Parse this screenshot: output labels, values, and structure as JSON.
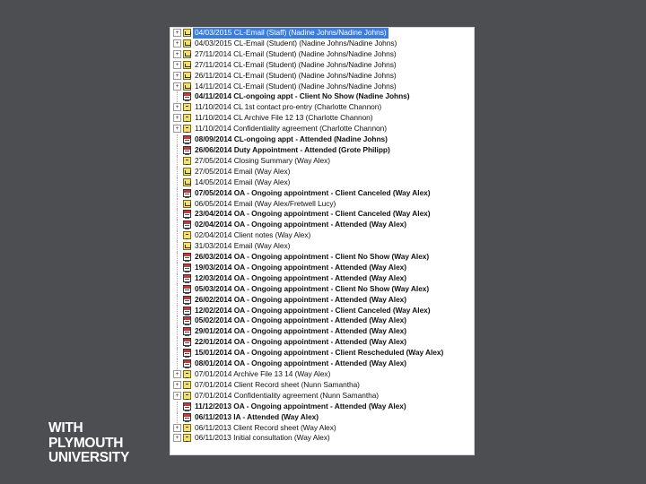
{
  "items": [
    {
      "expander": "+",
      "icon": "email-icon",
      "label": "04/03/2015 CL-Email (Staff) (Nadine Johns/Nadine Johns)",
      "bold": false,
      "selected": true
    },
    {
      "expander": "+",
      "icon": "email-icon",
      "label": "04/03/2015 CL-Email (Student) (Nadine Johns/Nadine Johns)",
      "bold": false
    },
    {
      "expander": "+",
      "icon": "email-icon",
      "label": "27/11/2014 CL-Email (Student) (Nadine Johns/Nadine Johns)",
      "bold": false
    },
    {
      "expander": "+",
      "icon": "email-icon",
      "label": "27/11/2014 CL-Email (Student) (Nadine Johns/Nadine Johns)",
      "bold": false
    },
    {
      "expander": "+",
      "icon": "email-icon",
      "label": "26/11/2014 CL-Email (Student) (Nadine Johns/Nadine Johns)",
      "bold": false
    },
    {
      "expander": "+",
      "icon": "email-icon",
      "label": "14/11/2014 CL-Email (Student) (Nadine Johns/Nadine Johns)",
      "bold": false
    },
    {
      "expander": "",
      "icon": "appointment-icon",
      "label": "04/11/2014 CL-ongoing appt - Client No Show (Nadine Johns)",
      "bold": true
    },
    {
      "expander": "+",
      "icon": "document-icon",
      "label": "11/10/2014 CL 1st contact pro-entry (Charlotte Channon)",
      "bold": false
    },
    {
      "expander": "+",
      "icon": "document-icon",
      "label": "11/10/2014 CL Archive File 12 13 (Charlotte Channon)",
      "bold": false
    },
    {
      "expander": "+",
      "icon": "document-icon",
      "label": "11/10/2014 Confidentiality agreement (Charlotte Channon)",
      "bold": false
    },
    {
      "expander": "",
      "icon": "appointment-icon",
      "label": "08/09/2014 CL-ongoing appt - Attended (Nadine Johns)",
      "bold": true
    },
    {
      "expander": "",
      "icon": "appointment-icon",
      "label": "26/06/2014 Duty Appointment - Attended (Grote Philipp)",
      "bold": true
    },
    {
      "expander": "",
      "icon": "document-icon",
      "label": "27/05/2014 Closing Summary (Way Alex)",
      "bold": false
    },
    {
      "expander": "",
      "icon": "email-icon",
      "label": "27/05/2014 Email (Way Alex)",
      "bold": false
    },
    {
      "expander": "",
      "icon": "email-icon",
      "label": "14/05/2014 Email (Way Alex)",
      "bold": false
    },
    {
      "expander": "",
      "icon": "appointment-icon",
      "label": "07/05/2014 OA - Ongoing appointment - Client Canceled (Way Alex)",
      "bold": true
    },
    {
      "expander": "",
      "icon": "email-icon",
      "label": "06/05/2014 Email (Way Alex/Fretwell Lucy)",
      "bold": false
    },
    {
      "expander": "",
      "icon": "appointment-icon",
      "label": "23/04/2014 OA - Ongoing appointment - Client Canceled (Way Alex)",
      "bold": true
    },
    {
      "expander": "",
      "icon": "appointment-icon",
      "label": "02/04/2014 OA - Ongoing appointment - Attended (Way Alex)",
      "bold": true
    },
    {
      "expander": "",
      "icon": "document-icon",
      "label": "02/04/2014 Client notes (Way Alex)",
      "bold": false
    },
    {
      "expander": "",
      "icon": "email-icon",
      "label": "31/03/2014 Email (Way Alex)",
      "bold": false
    },
    {
      "expander": "",
      "icon": "appointment-icon",
      "label": "26/03/2014 OA - Ongoing appointment - Client No Show (Way Alex)",
      "bold": true
    },
    {
      "expander": "",
      "icon": "appointment-icon",
      "label": "19/03/2014 OA - Ongoing appointment - Attended (Way Alex)",
      "bold": true
    },
    {
      "expander": "",
      "icon": "appointment-icon",
      "label": "12/03/2014 OA - Ongoing appointment - Attended (Way Alex)",
      "bold": true
    },
    {
      "expander": "",
      "icon": "appointment-icon",
      "label": "05/03/2014 OA - Ongoing appointment - Client No Show (Way Alex)",
      "bold": true
    },
    {
      "expander": "",
      "icon": "appointment-icon",
      "label": "26/02/2014 OA - Ongoing appointment - Attended (Way Alex)",
      "bold": true
    },
    {
      "expander": "",
      "icon": "appointment-icon",
      "label": "12/02/2014 OA - Ongoing appointment - Client Canceled (Way Alex)",
      "bold": true
    },
    {
      "expander": "",
      "icon": "appointment-icon",
      "label": "05/02/2014 OA - Ongoing appointment - Attended (Way Alex)",
      "bold": true
    },
    {
      "expander": "",
      "icon": "appointment-icon",
      "label": "29/01/2014 OA - Ongoing appointment - Attended (Way Alex)",
      "bold": true
    },
    {
      "expander": "",
      "icon": "appointment-icon",
      "label": "22/01/2014 OA - Ongoing appointment - Attended (Way Alex)",
      "bold": true
    },
    {
      "expander": "",
      "icon": "appointment-icon",
      "label": "15/01/2014 OA - Ongoing appointment - Client Rescheduled (Way Alex)",
      "bold": true
    },
    {
      "expander": "",
      "icon": "appointment-icon",
      "label": "08/01/2014 OA - Ongoing appointment - Attended (Way Alex)",
      "bold": true
    },
    {
      "expander": "+",
      "icon": "document-icon",
      "label": "07/01/2014 Archive File 13 14 (Way Alex)",
      "bold": false
    },
    {
      "expander": "+",
      "icon": "document-icon",
      "label": "07/01/2014 Client Record sheet (Nunn Samantha)",
      "bold": false
    },
    {
      "expander": "+",
      "icon": "document-icon",
      "label": "07/01/2014 Confidentiality agreement (Nunn Samantha)",
      "bold": false
    },
    {
      "expander": "",
      "icon": "appointment-icon",
      "label": "11/12/2013 OA - Ongoing appointment - Attended (Way Alex)",
      "bold": true
    },
    {
      "expander": "",
      "icon": "appointment-icon",
      "label": "06/11/2013 IA - Attended (Way Alex)",
      "bold": true
    },
    {
      "expander": "+",
      "icon": "document-icon",
      "label": "06/11/2013 Client Record sheet (Way Alex)",
      "bold": false
    },
    {
      "expander": "+",
      "icon": "document-icon",
      "label": "06/11/2013 Initial consultation (Way Alex)",
      "bold": false
    }
  ],
  "logo": {
    "line1": "WITH",
    "line2": "PLYMOUTH",
    "line3": "UNIVERSITY"
  },
  "colors": {
    "background": "#4d4e51",
    "selection": "#3a7de0",
    "appointment": "#c83a3a",
    "email": "#f4e070"
  }
}
